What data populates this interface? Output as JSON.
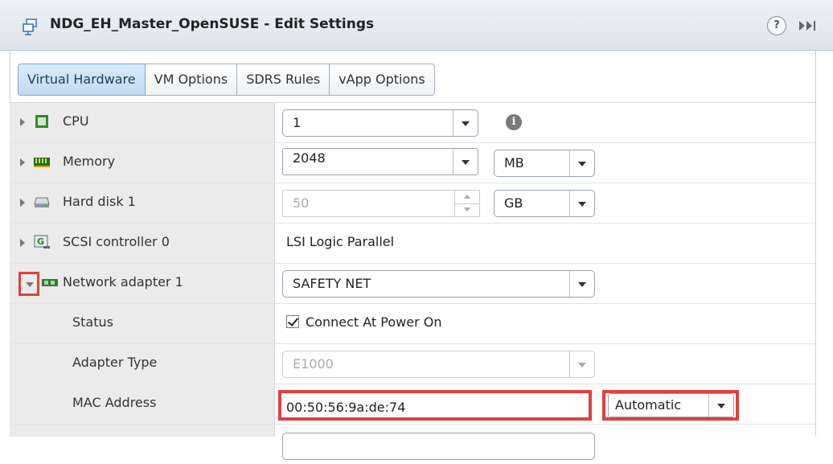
{
  "window": {
    "title": "NDG_EH_Master_OpenSUSE - Edit Settings",
    "help": "?"
  },
  "tabs": [
    {
      "label": "Virtual Hardware",
      "active": true
    },
    {
      "label": "VM Options"
    },
    {
      "label": "SDRS Rules"
    },
    {
      "label": "vApp Options"
    }
  ],
  "hardware": {
    "cpu": {
      "label": "CPU",
      "value": "1"
    },
    "memory": {
      "label": "Memory",
      "value": "2048",
      "unit": "MB"
    },
    "disk": {
      "label": "Hard disk 1",
      "value": "50",
      "unit": "GB"
    },
    "scsi": {
      "label": "SCSI controller 0",
      "value": "LSI Logic Parallel"
    },
    "network": {
      "label": "Network adapter 1",
      "value": "SAFETY NET",
      "status": {
        "label": "Status",
        "checkbox_label": "Connect At Power On",
        "checked": true
      },
      "adapter_type": {
        "label": "Adapter Type",
        "value": "E1000"
      },
      "mac": {
        "label": "MAC Address",
        "value": "00:50:56:9a:de:74",
        "mode": "Automatic"
      }
    }
  },
  "colors": {
    "highlight": "#e0403f",
    "tab_active": "#c2dcf3",
    "label_bg": "#ebebeb"
  }
}
